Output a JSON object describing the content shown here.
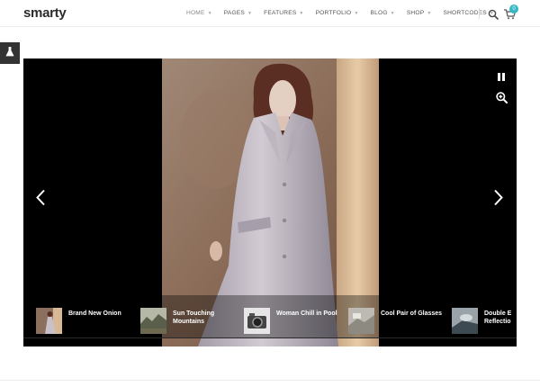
{
  "brand": {
    "logo_text": "smarty",
    "accent_color": "#35b8c4"
  },
  "nav": {
    "items": [
      {
        "label": "HOME",
        "active": true
      },
      {
        "label": "PAGES"
      },
      {
        "label": "FEATURES"
      },
      {
        "label": "PORTFOLIO"
      },
      {
        "label": "BLOG"
      },
      {
        "label": "SHOP"
      },
      {
        "label": "SHORTCODES"
      }
    ],
    "search_icon": "search-icon",
    "cart_icon": "cart-icon",
    "cart_count": "0"
  },
  "side_tool": {
    "icon": "flask-icon"
  },
  "slider": {
    "controls": {
      "pause_icon": "pause-icon",
      "zoom_icon": "zoom-in-icon",
      "prev_icon": "chevron-left-icon",
      "next_icon": "chevron-right-icon"
    },
    "thumbnails": [
      {
        "title": "Brand New Onion"
      },
      {
        "title": "Sun Touching\nMountains"
      },
      {
        "title": "Woman Chill in Pool"
      },
      {
        "title": "Cool Pair of Glasses"
      },
      {
        "title": "Double E\nReflectio"
      }
    ]
  }
}
